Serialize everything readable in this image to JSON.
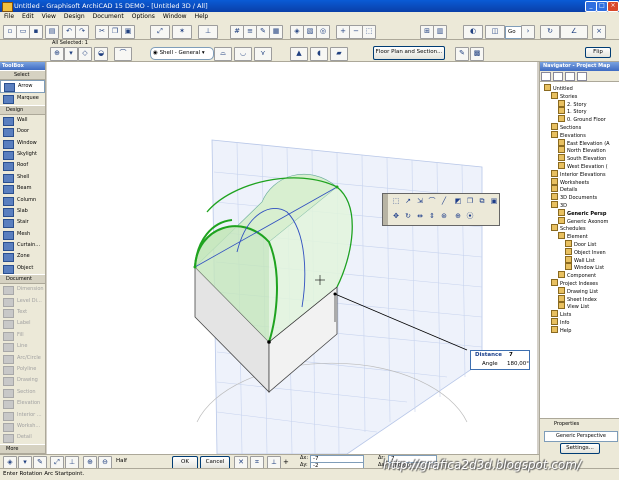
{
  "window": {
    "title": "Untitled - Graphisoft ArchiCAD 15 DEMO - [Untitled 3D / All]",
    "min": "_",
    "max": "□",
    "close": "×"
  },
  "menu": [
    "File",
    "Edit",
    "View",
    "Design",
    "Document",
    "Options",
    "Window",
    "Help"
  ],
  "toolbar": {
    "all_selected": "All Selected: 1",
    "shell_combo": "Shell - General",
    "floor_plan_section_button": "Floor Plan and Section...",
    "go_label": "Go",
    "flip_button": "Flip"
  },
  "toolbox": {
    "title": "ToolBox",
    "select_label": "Select",
    "selection_tools": [
      "Arrow",
      "Marquee"
    ],
    "design_label": "Design",
    "design_tools": [
      "Wall",
      "Door",
      "Window",
      "Skylight",
      "Roof",
      "Shell",
      "Beam",
      "Column",
      "Slab",
      "Stair",
      "Mesh",
      "Curtain...",
      "Zone",
      "Object"
    ],
    "document_label": "Document",
    "document_tools": [
      "Dimension",
      "Level Di...",
      "Text",
      "Label",
      "Fill",
      "Line",
      "Arc/Circle",
      "Polyline",
      "Drawing",
      "Section",
      "Elevation",
      "Interior ...",
      "Worksh...",
      "Detail"
    ],
    "more_label": "More"
  },
  "navigator": {
    "title": "Navigator - Project Map",
    "tree": [
      {
        "label": "Untitled",
        "level": 0
      },
      {
        "label": "Stories",
        "level": 1
      },
      {
        "label": "2. Story",
        "level": 2
      },
      {
        "label": "1. Story",
        "level": 2
      },
      {
        "label": "0. Ground Floor",
        "level": 2
      },
      {
        "label": "Sections",
        "level": 1
      },
      {
        "label": "Elevations",
        "level": 1
      },
      {
        "label": "East Elevation (A",
        "level": 2
      },
      {
        "label": "North Elevation",
        "level": 2
      },
      {
        "label": "South Elevation",
        "level": 2
      },
      {
        "label": "West Elevation (",
        "level": 2
      },
      {
        "label": "Interior Elevations",
        "level": 1
      },
      {
        "label": "Worksheets",
        "level": 1
      },
      {
        "label": "Details",
        "level": 1
      },
      {
        "label": "3D Documents",
        "level": 1
      },
      {
        "label": "3D",
        "level": 1
      },
      {
        "label": "Generic Persp",
        "level": 2,
        "bold": true
      },
      {
        "label": "Generic Axonom",
        "level": 2
      },
      {
        "label": "Schedules",
        "level": 1
      },
      {
        "label": "Element",
        "level": 2
      },
      {
        "label": "Door List",
        "level": 3
      },
      {
        "label": "Object Inven",
        "level": 3
      },
      {
        "label": "Wall List",
        "level": 3
      },
      {
        "label": "Window List",
        "level": 3
      },
      {
        "label": "Component",
        "level": 2
      },
      {
        "label": "Project Indexes",
        "level": 1
      },
      {
        "label": "Drawing List",
        "level": 2
      },
      {
        "label": "Sheet Index",
        "level": 2
      },
      {
        "label": "View List",
        "level": 2
      },
      {
        "label": "Lists",
        "level": 1
      },
      {
        "label": "Info",
        "level": 1
      },
      {
        "label": "Help",
        "level": 1
      }
    ],
    "properties_label": "Properties",
    "properties_value": "Generic Perspective",
    "settings_button": "Settings..."
  },
  "tracker": {
    "distance_label": "Distance",
    "distance_value": "7",
    "angle_label": "Angle",
    "angle_value": "180,00°"
  },
  "bottombar": {
    "zoom_label": "Half",
    "ok_button": "OK",
    "cancel_button": "Cancel",
    "dx_label": "Δx:",
    "dx_value": "-7",
    "dy_label": "Δy:",
    "dy_value": "-2",
    "dr_label": "Δr:",
    "dr_value": "7",
    "da_label": "Δa:",
    "da_value": "180,00°"
  },
  "status_text": "Enter Rotation Arc Startpoint.",
  "watermark": "http://grafica2d3d.blogspot.com/"
}
